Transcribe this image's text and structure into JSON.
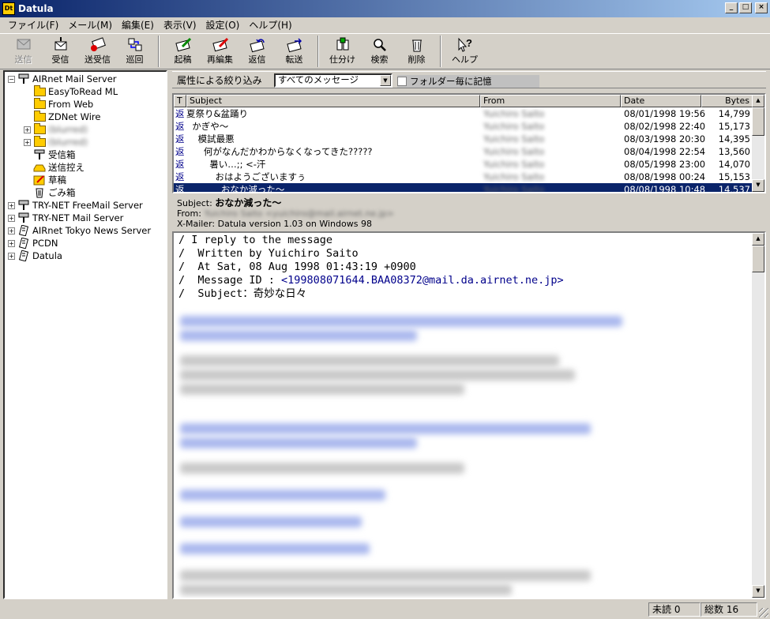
{
  "window": {
    "title": "Datula",
    "icon_text": "Dt",
    "minimize": "_",
    "maximize": "□",
    "close": "×"
  },
  "menu": [
    "ファイル(F)",
    "メール(M)",
    "編集(E)",
    "表示(V)",
    "設定(O)",
    "ヘルプ(H)"
  ],
  "toolbar": {
    "group1": [
      {
        "label": "送信",
        "icon": "send-icon",
        "disabled": true
      },
      {
        "label": "受信",
        "icon": "receive-icon"
      },
      {
        "label": "送受信",
        "icon": "send-receive-icon"
      },
      {
        "label": "巡回",
        "icon": "patrol-icon"
      }
    ],
    "group2": [
      {
        "label": "起稿",
        "icon": "compose-icon"
      },
      {
        "label": "再編集",
        "icon": "reedit-icon"
      },
      {
        "label": "返信",
        "icon": "reply-icon"
      },
      {
        "label": "転送",
        "icon": "forward-icon"
      }
    ],
    "group3": [
      {
        "label": "仕分け",
        "icon": "sort-icon"
      },
      {
        "label": "検索",
        "icon": "search-icon"
      },
      {
        "label": "削除",
        "icon": "delete-icon"
      }
    ],
    "group4": [
      {
        "label": "ヘルプ",
        "icon": "help-icon"
      }
    ]
  },
  "tree": {
    "items": [
      {
        "label": "AIRnet Mail Server",
        "icon": "server-icon",
        "expander": "−"
      },
      {
        "label": "EasyToRead ML",
        "icon": "folder-icon"
      },
      {
        "label": "From Web",
        "icon": "folder-icon"
      },
      {
        "label": "ZDNet Wire",
        "icon": "folder-icon"
      },
      {
        "label": "(blurred)",
        "icon": "folder-icon",
        "expander": "+"
      },
      {
        "label": "(blurred)",
        "icon": "folder-icon",
        "expander": "+"
      },
      {
        "label": "受信箱",
        "icon": "inbox-icon"
      },
      {
        "label": "送信控え",
        "icon": "sent-icon"
      },
      {
        "label": "草稿",
        "icon": "draft-icon"
      },
      {
        "label": "ごみ箱",
        "icon": "trash-icon"
      },
      {
        "label": "TRY-NET FreeMail Server",
        "icon": "server-icon",
        "expander": "+"
      },
      {
        "label": "TRY-NET Mail Server",
        "icon": "server-icon",
        "expander": "+"
      },
      {
        "label": "AIRnet Tokyo News Server",
        "icon": "news-server-icon",
        "expander": "+"
      },
      {
        "label": "PCDN",
        "icon": "news-server-icon",
        "expander": "+"
      },
      {
        "label": "Datula",
        "icon": "news-server-icon",
        "expander": "+"
      }
    ]
  },
  "filter": {
    "label": "属性による絞り込み",
    "selected": "すべてのメッセージ",
    "checkbox_label": "フォルダー毎に記憶"
  },
  "list": {
    "headers": {
      "t": "T",
      "subject": "Subject",
      "from": "From",
      "date": "Date",
      "bytes": "Bytes"
    },
    "rows": [
      {
        "t": "返",
        "subject": "夏祭り&盆踊り",
        "from": "Yuichiro Saito",
        "date": "08/01/1998 19:56",
        "bytes": "14,799"
      },
      {
        "t": "返",
        "subject": "  かぎや～",
        "from": "Yuichiro Saito",
        "date": "08/02/1998 22:40",
        "bytes": "15,173"
      },
      {
        "t": "返",
        "subject": "    模試最悪",
        "from": "Yuichiro Saito",
        "date": "08/03/1998 20:30",
        "bytes": "14,395"
      },
      {
        "t": "返",
        "subject": "      何がなんだかわからなくなってきた?????",
        "from": "Yuichiro Saito",
        "date": "08/04/1998 22:54",
        "bytes": "13,560"
      },
      {
        "t": "返",
        "subject": "        暑い…;; <-汗",
        "from": "Yuichiro Saito",
        "date": "08/05/1998 23:00",
        "bytes": "14,070"
      },
      {
        "t": "返",
        "subject": "          おはようございますぅ",
        "from": "Yuichiro Saito",
        "date": "08/08/1998 00:24",
        "bytes": "15,153"
      },
      {
        "t": "返",
        "subject": "            おなか減った～",
        "from": "Yuichiro Saito",
        "date": "08/08/1998 10:48",
        "bytes": "14,537",
        "selected": true
      }
    ]
  },
  "preview": {
    "subject_label": "Subject:",
    "subject": "おなか減った～",
    "from_label": "From:",
    "from_value": "Yuichiro Saito <yuichiro@mail.airnet.ne.jp>",
    "xmailer_label": "X-Mailer:",
    "xmailer": "Datula version 1.03 on Windows 98"
  },
  "body": {
    "line1": "/ I reply to the message",
    "line2": "/  Written by Yuichiro Saito",
    "line3": "/  At Sat, 08 Aug 1998 01:43:19 +0900",
    "line4_prefix": "/  Message ID : ",
    "message_id": "<199808071644.BAA08372@mail.da.airnet.ne.jp>",
    "line5": "/  Subject：奇妙な日々"
  },
  "status": {
    "unread": "未読 0",
    "total": "総数 16"
  }
}
